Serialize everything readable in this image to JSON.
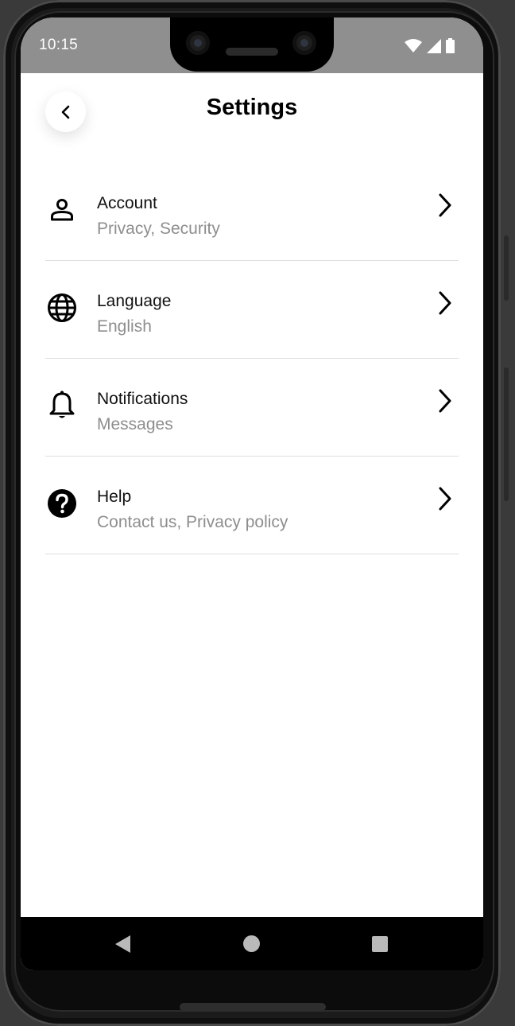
{
  "status_bar": {
    "time": "10:15",
    "icons": [
      "wifi-icon",
      "cell-signal-icon",
      "battery-icon"
    ]
  },
  "header": {
    "title": "Settings",
    "back_icon": "chevron-left-icon"
  },
  "settings": [
    {
      "label": "Account",
      "sub": "Privacy, Security",
      "icon": "person-icon"
    },
    {
      "label": "Language",
      "sub": "English",
      "icon": "globe-icon"
    },
    {
      "label": "Notifications",
      "sub": "Messages",
      "icon": "bell-icon"
    },
    {
      "label": "Help",
      "sub": "Contact us, Privacy policy",
      "icon": "help-circle-icon"
    }
  ],
  "nav_bar": {
    "buttons": [
      "nav-back-icon",
      "nav-home-icon",
      "nav-recents-icon"
    ]
  },
  "colors": {
    "status_bar_bg": "#8f8f8f",
    "subtitle_text": "#8e8e8e",
    "divider": "#dedede",
    "nav_bar_bg": "#000000"
  }
}
